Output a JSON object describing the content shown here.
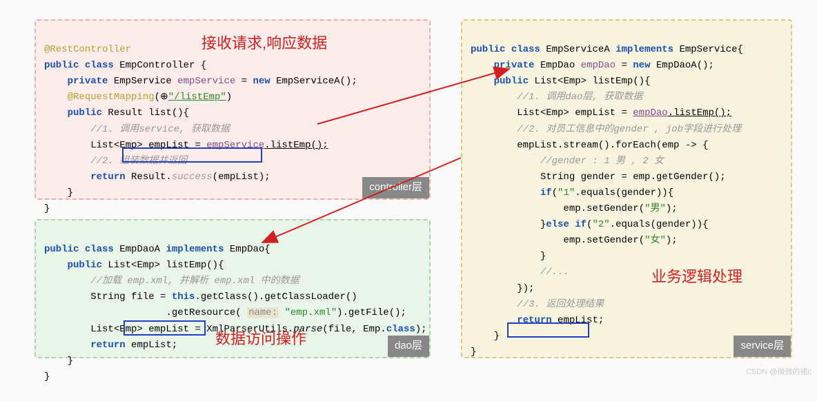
{
  "labels": {
    "controller_title": "接收请求,响应数据",
    "service_title": "业务逻辑处理",
    "dao_title": "数据访问操作",
    "controller_badge": "controller层",
    "dao_badge": "dao层",
    "service_badge": "service层"
  },
  "controller": {
    "l1": "@RestController",
    "l2a": "public",
    "l2b": "class",
    "l2c": " EmpController {",
    "l3a": "private",
    "l3b": " EmpService ",
    "l3c": "empService",
    "l3d": " = ",
    "l3e": "new",
    "l3f": " EmpServiceA();",
    "l4a": "@RequestMapping",
    "l4b": "(",
    "l4c": "\"/listEmp\"",
    "l4d": ")",
    "l5a": "public",
    "l5b": " Result ",
    "l5c": "list",
    "l5d": "(){",
    "l6": "//1. 调用service, 获取数据",
    "l7a": "List<Emp> empList = ",
    "l7b": "empService",
    "l7c": ".listEmp();",
    "l8": "//2. 组装数据并返回",
    "l9a": "return",
    "l9b": " Result.",
    "l9c": "success",
    "l9d": "(empList);",
    "l10": "}",
    "l11": "}"
  },
  "dao": {
    "l1a": "public",
    "l1b": "class",
    "l1c": " EmpDaoA ",
    "l1d": "implements",
    "l1e": " EmpDao{",
    "l2a": "public",
    "l2b": " List<Emp> ",
    "l2c": "listEmp",
    "l2d": "(){",
    "l3": "//加载 emp.xml, 并解析 emp.xml 中的数据",
    "l4a": "String file = ",
    "l4b": "this",
    "l4c": ".getClass().getClassLoader()",
    "l5a": ".getResource( ",
    "l5p": "name:",
    "l5b": " \"emp.xml\"",
    "l5c": ").getFile();",
    "l6a": "List<Emp> empList = XmlParserUtils.",
    "l6b": "parse",
    "l6c": "(file, Emp.",
    "l6d": "class",
    "l6e": ");",
    "l7a": "return",
    "l7b": " empList;",
    "l8": "}",
    "l9": "}"
  },
  "service": {
    "l1a": "public",
    "l1b": "class",
    "l1c": " EmpServiceA ",
    "l1d": "implements",
    "l1e": " EmpService{",
    "l2a": "private",
    "l2b": " EmpDao ",
    "l2c": "empDao",
    "l2d": " = ",
    "l2e": "new",
    "l2f": " EmpDaoA();",
    "l3a": "public",
    "l3b": " List<Emp> ",
    "l3c": "listEmp",
    "l3d": "(){",
    "l4": "//1. 调用dao层, 获取数据",
    "l5a": "List<Emp> empList = ",
    "l5b": "empDao",
    "l5c": ".listEmp();",
    "l6": "//2. 对员工信息中的gender , job字段进行处理",
    "l7": "empList.stream().forEach(emp -> {",
    "l8": "//gender : 1 男 , 2 女",
    "l9": "String gender = emp.getGender();",
    "l10a": "if",
    "l10b": "(",
    "l10c": "\"1\"",
    "l10d": ".equals(gender)){",
    "l11a": "emp.setGender(",
    "l11b": "\"男\"",
    "l11c": ");",
    "l12a": "}",
    "l12b": "else if",
    "l12c": "(",
    "l12d": "\"2\"",
    "l12e": ".equals(gender)){",
    "l13a": "emp.setGender(",
    "l13b": "\"女\"",
    "l13c": ");",
    "l14": "}",
    "l15": "//...",
    "l16": "});",
    "l17": "//3. 返回处理结果",
    "l18a": "return",
    "l18b": " empList;",
    "l19": "}",
    "l20": "}"
  },
  "watermark": "CSDN @微微的猪c"
}
